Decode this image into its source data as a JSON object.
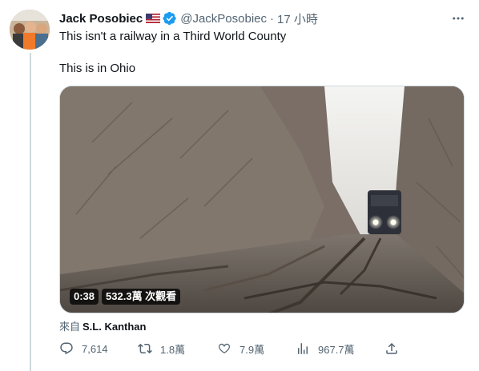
{
  "author": {
    "display_name": "Jack Posobiec",
    "handle": "@JackPosobiec",
    "separator": "·",
    "timestamp": "17 小時"
  },
  "tweet": {
    "line1": "This isn't a railway in a Third World County",
    "line2": "This is in Ohio"
  },
  "video": {
    "duration": "0:38",
    "views": "532.3萬 次觀看"
  },
  "source": {
    "prefix": "來自",
    "name": "S.L. Kanthan"
  },
  "actions": {
    "reply_count": "7,614",
    "retweet_count": "1.8萬",
    "like_count": "7.9萬",
    "view_count": "967.7萬"
  },
  "colors": {
    "verified": "#1d9bf0",
    "secondary_text": "#536471",
    "primary_text": "#0f1419"
  }
}
